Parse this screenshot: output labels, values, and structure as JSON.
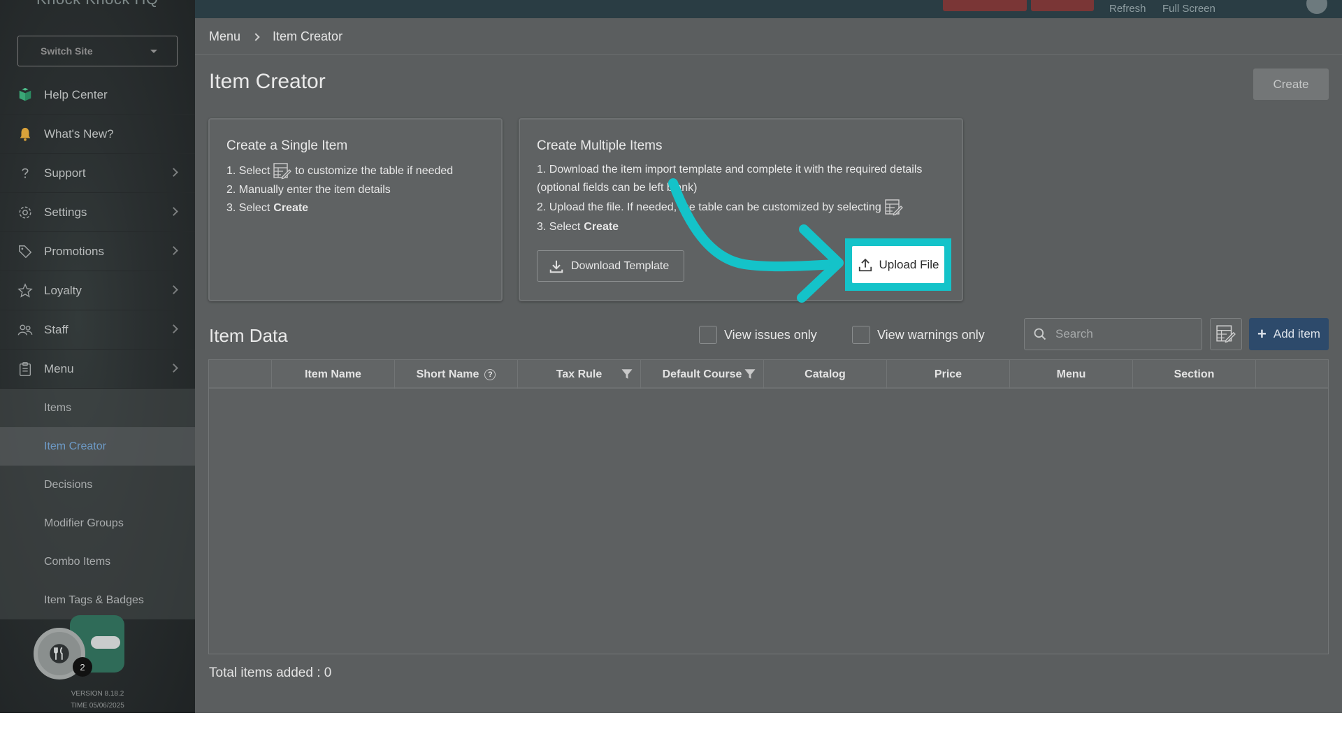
{
  "sidebar": {
    "brand": "Knock Knock HQ",
    "switch_site_label": "Switch Site",
    "items": [
      {
        "label": "Help Center",
        "icon": "book-icon"
      },
      {
        "label": "What's New?",
        "icon": "bell-icon"
      },
      {
        "label": "Support",
        "icon": "question-icon"
      },
      {
        "label": "Settings",
        "icon": "gear-icon"
      },
      {
        "label": "Promotions",
        "icon": "tag-icon"
      },
      {
        "label": "Loyalty",
        "icon": "star-icon"
      },
      {
        "label": "Staff",
        "icon": "people-icon"
      },
      {
        "label": "Menu",
        "icon": "clipboard-icon"
      }
    ],
    "menu_sub_items": [
      "Items",
      "Item Creator",
      "Decisions",
      "Modifier Groups",
      "Combo Items",
      "Item Tags & Badges"
    ],
    "active_sub_item": "Item Creator",
    "badge_count": "2",
    "version": "VERSION 8.18.2",
    "time": "TIME 05/06/2025"
  },
  "topbar": {
    "refresh": "Refresh",
    "full_screen": "Full Screen"
  },
  "breadcrumb": [
    "Menu",
    "Item Creator"
  ],
  "page": {
    "title": "Item Creator",
    "create_label": "Create"
  },
  "single": {
    "title": "Create a Single Item",
    "step1_pre": "1. Select",
    "step1_post": "to customize the table if needed",
    "step2": "2. Manually enter the item details",
    "step3_pre": "3. Select",
    "step3_bold": "Create"
  },
  "multiple": {
    "title": "Create Multiple Items",
    "step1a": "1. Download the item import template and complete it with the required details",
    "step1b": "(optional fields can be left blank)",
    "step2": "2. Upload the file. If needed, the table can be customized by selecting",
    "step3_pre": "3. Select",
    "step3_bold": "Create",
    "download_label": "Download Template",
    "upload_label": "Upload File"
  },
  "item_data": {
    "title": "Item Data",
    "view_issues": "View issues only",
    "view_warnings": "View warnings only",
    "search_placeholder": "Search",
    "add_item": "Add item",
    "columns": [
      "",
      "Item Name",
      "Short Name",
      "Tax Rule",
      "Default Course",
      "Catalog",
      "Price",
      "Menu",
      "Section",
      ""
    ],
    "total": "Total items added : 0"
  },
  "colors": {
    "highlight": "#14c3c9",
    "add_button": "#2d4a6b",
    "active_sub_item": "#6d9ac6"
  }
}
